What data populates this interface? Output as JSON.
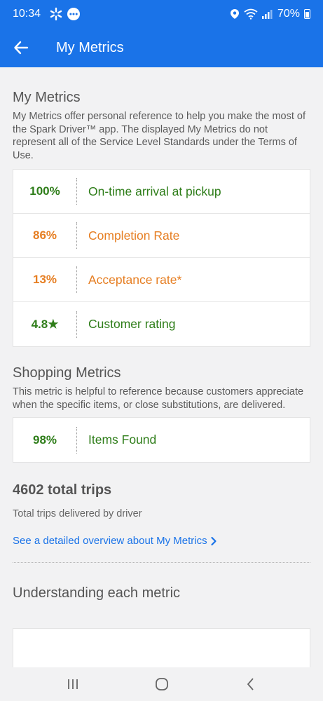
{
  "status_bar": {
    "time": "10:34",
    "battery": "70%"
  },
  "app_bar": {
    "title": "My Metrics"
  },
  "my_metrics": {
    "title": "My Metrics",
    "description": "My Metrics offer personal reference to help you make the most of the Spark Driver™ app. The displayed My Metrics do not represent all of the Service Level Standards under the Terms of Use.",
    "rows": [
      {
        "value": "100%",
        "label": "On-time arrival at pickup",
        "color": "#2e7d19"
      },
      {
        "value": "86%",
        "label": "Completion Rate",
        "color": "#e67e22"
      },
      {
        "value": "13%",
        "label": "Acceptance rate*",
        "color": "#e67e22"
      },
      {
        "value": "4.8★",
        "label": "Customer rating",
        "color": "#2e7d19"
      }
    ]
  },
  "shopping_metrics": {
    "title": "Shopping Metrics",
    "description": "This metric is helpful to reference because customers appreciate when the specific items, or close substitutions, are delivered.",
    "rows": [
      {
        "value": "98%",
        "label": "Items Found",
        "color": "#2e7d19"
      }
    ]
  },
  "trips": {
    "title": "4602 total trips",
    "subtitle": "Total trips delivered by driver",
    "link": "See a detailed overview about My Metrics"
  },
  "understanding": {
    "title": "Understanding each metric"
  },
  "colors": {
    "accent": "#1a73e8",
    "good": "#2e7d19",
    "warning": "#e67e22"
  },
  "icons": {
    "back": "arrow-left-icon",
    "link_chevron": "chevron-right-icon"
  }
}
